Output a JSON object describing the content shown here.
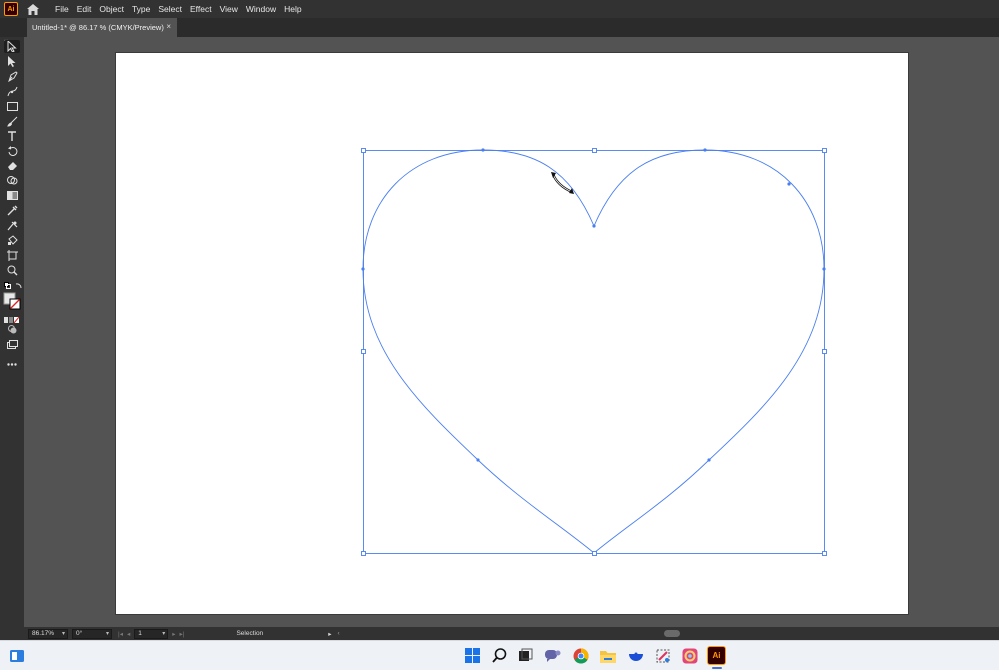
{
  "app": {
    "logo_text": "Ai"
  },
  "menubar": {
    "items": [
      "File",
      "Edit",
      "Object",
      "Type",
      "Select",
      "Effect",
      "View",
      "Window",
      "Help"
    ]
  },
  "document_tab": {
    "title": "Untitled-1* @ 86.17 % (CMYK/Preview)",
    "close_glyph": "×"
  },
  "toolbar": {
    "grip": "••"
  },
  "statusbar": {
    "zoom": "86.17%",
    "rotation": "0°",
    "artboard_number": "1",
    "status_text": "Selection"
  },
  "taskbar": {
    "illustrator_label": "Ai"
  },
  "colors": {
    "accent": "#4a7ff0",
    "app_orange": "#ff9a00"
  }
}
